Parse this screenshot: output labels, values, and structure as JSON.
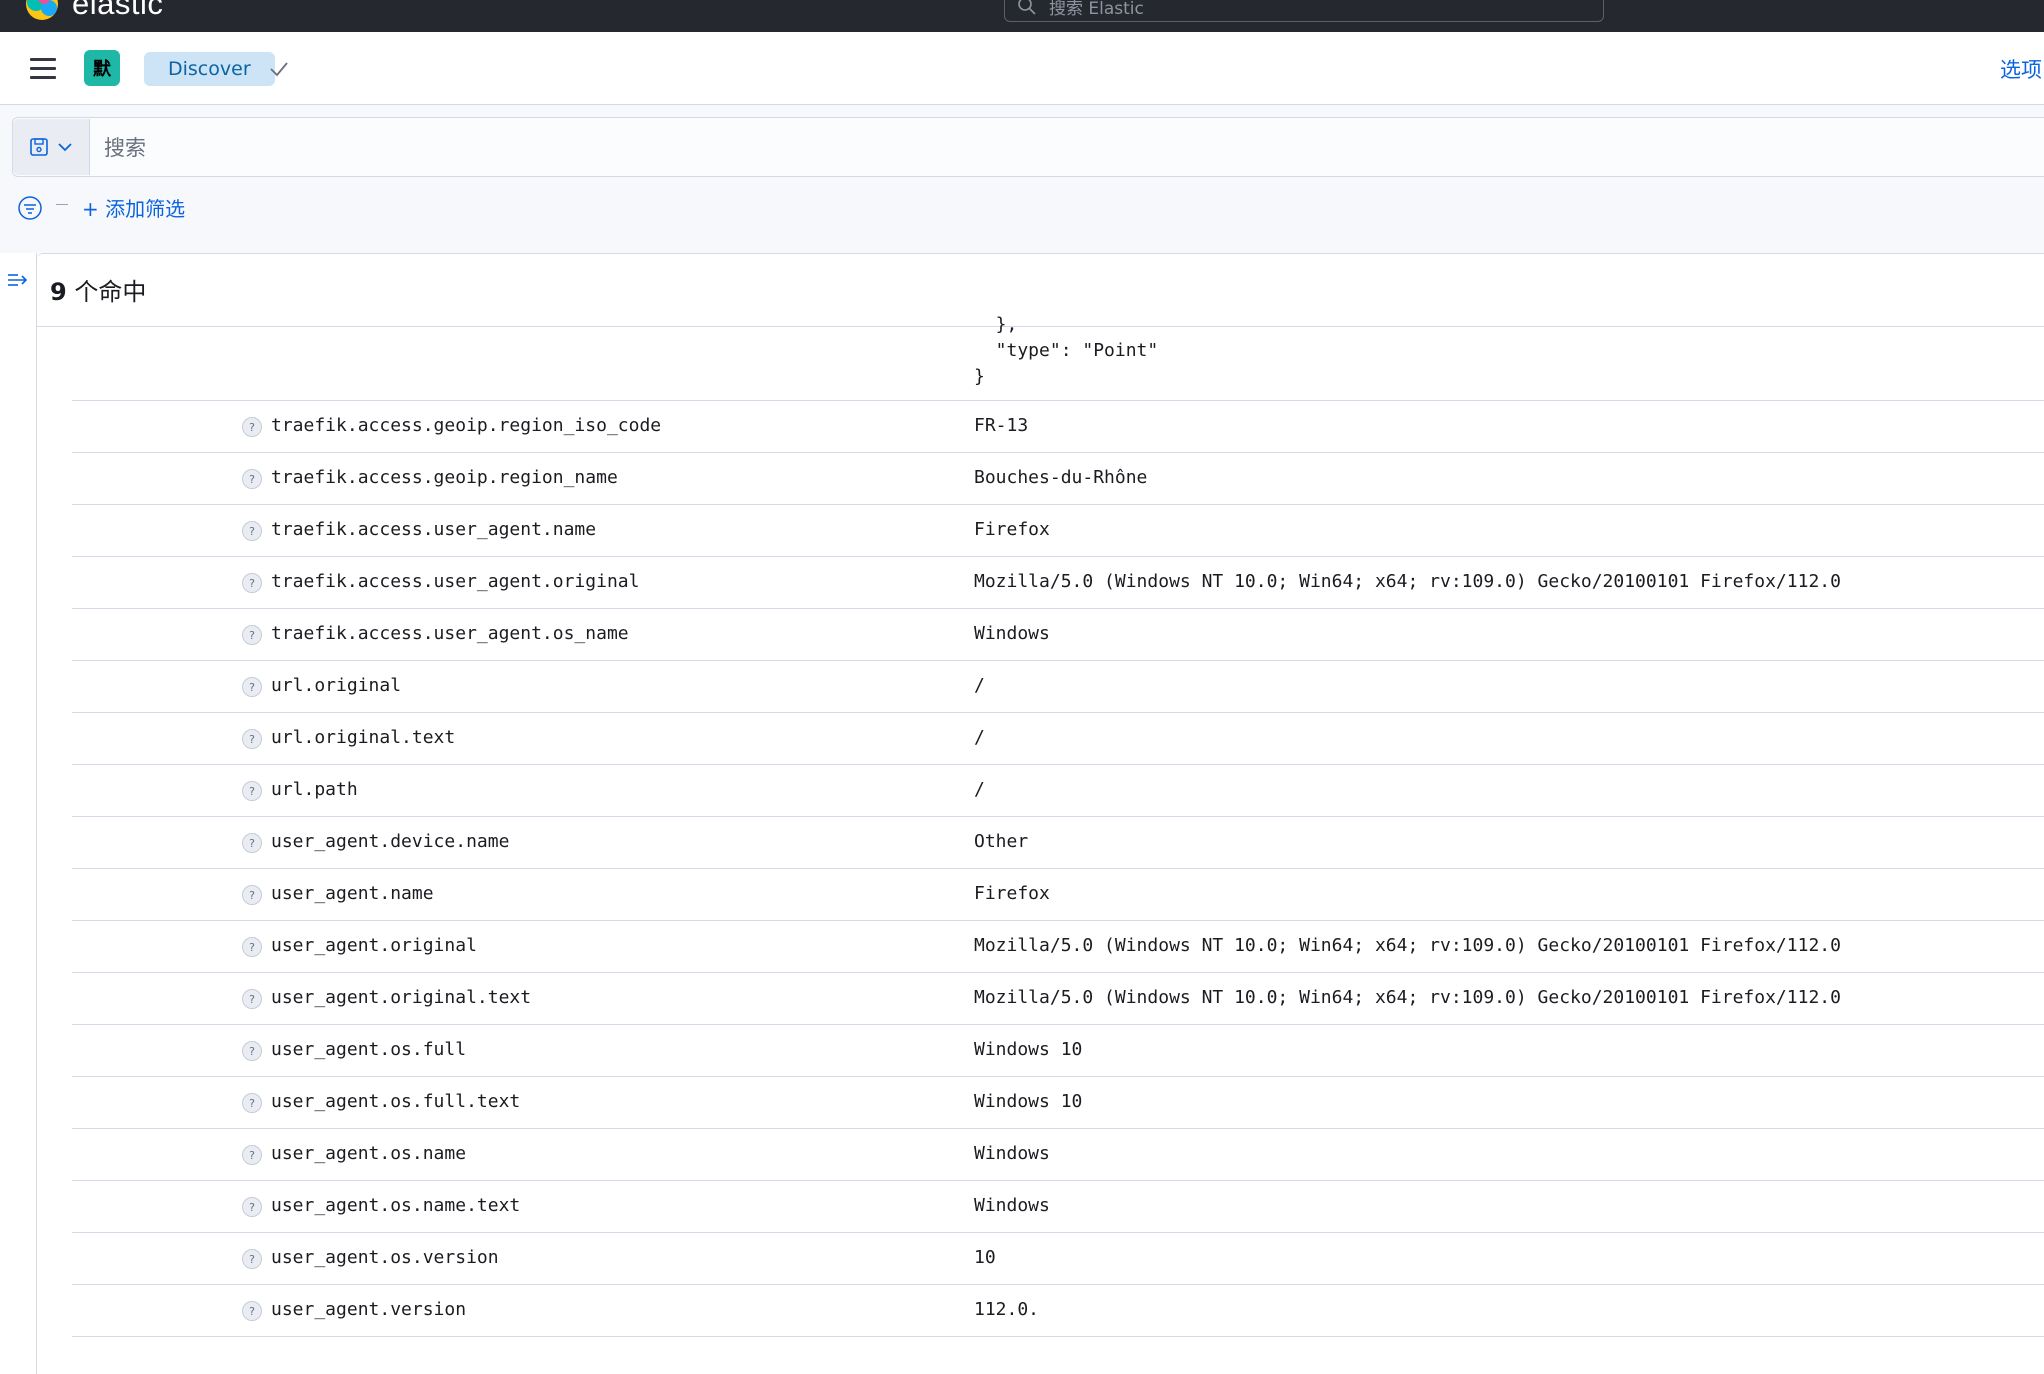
{
  "header": {
    "logo_text": "elastic",
    "global_search_placeholder": "搜索 Elastic"
  },
  "nav": {
    "space_initial": "默",
    "breadcrumb": "Discover",
    "options_link": "选项"
  },
  "query": {
    "placeholder": "搜索",
    "add_filter": "+ 添加筛选"
  },
  "results": {
    "hits_number": "9",
    "hits_label": "个命中"
  },
  "doc_viewer": {
    "json_tail": [
      "  },",
      "  \"type\": \"Point\"",
      "}"
    ],
    "rows": [
      {
        "field": "traefik.access.geoip.region_iso_code",
        "value": "FR-13"
      },
      {
        "field": "traefik.access.geoip.region_name",
        "value": "Bouches-du-Rhône"
      },
      {
        "field": "traefik.access.user_agent.name",
        "value": "Firefox"
      },
      {
        "field": "traefik.access.user_agent.original",
        "value": "Mozilla/5.0 (Windows NT 10.0; Win64; x64; rv:109.0) Gecko/20100101 Firefox/112.0"
      },
      {
        "field": "traefik.access.user_agent.os_name",
        "value": "Windows"
      },
      {
        "field": "url.original",
        "value": "/"
      },
      {
        "field": "url.original.text",
        "value": "/"
      },
      {
        "field": "url.path",
        "value": "/"
      },
      {
        "field": "user_agent.device.name",
        "value": "Other"
      },
      {
        "field": "user_agent.name",
        "value": "Firefox"
      },
      {
        "field": "user_agent.original",
        "value": "Mozilla/5.0 (Windows NT 10.0; Win64; x64; rv:109.0) Gecko/20100101 Firefox/112.0"
      },
      {
        "field": "user_agent.original.text",
        "value": "Mozilla/5.0 (Windows NT 10.0; Win64; x64; rv:109.0) Gecko/20100101 Firefox/112.0"
      },
      {
        "field": "user_agent.os.full",
        "value": "Windows 10"
      },
      {
        "field": "user_agent.os.full.text",
        "value": "Windows 10"
      },
      {
        "field": "user_agent.os.name",
        "value": "Windows"
      },
      {
        "field": "user_agent.os.name.text",
        "value": "Windows"
      },
      {
        "field": "user_agent.os.version",
        "value": "10"
      },
      {
        "field": "user_agent.version",
        "value": "112.0."
      }
    ],
    "field_type_icon": "unknown-field-icon",
    "field_type_glyph": "?"
  },
  "colors": {
    "header_bg": "#25282f",
    "accent": "#0b64dd",
    "space_avatar": "#1fb7a5",
    "breadcrumb_bg": "#cce4f5"
  }
}
